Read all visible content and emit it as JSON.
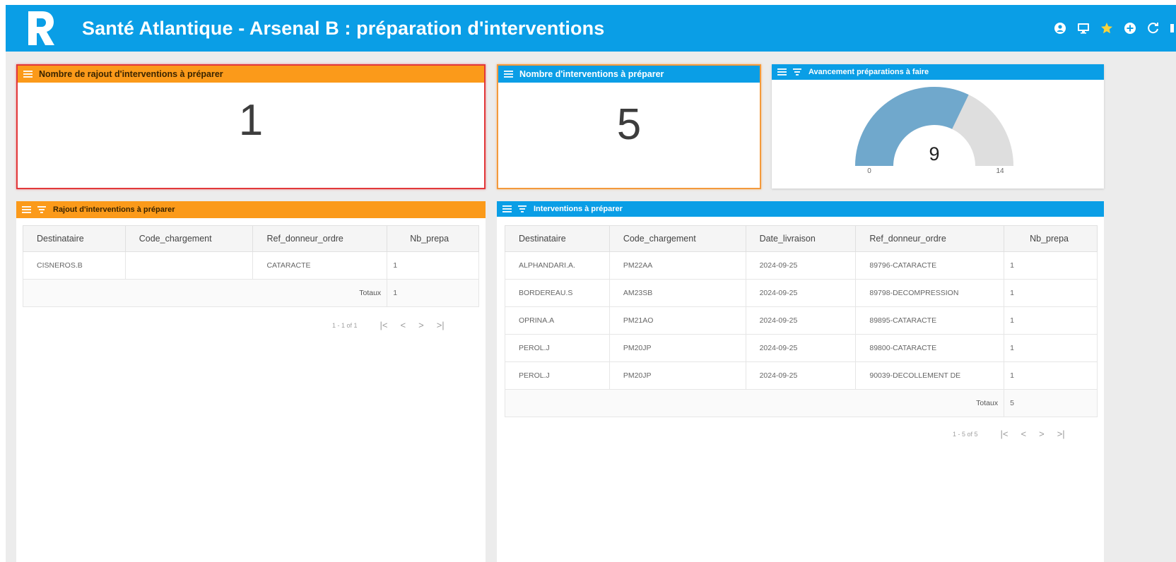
{
  "header": {
    "title": "Santé Atlantique - Arsenal B : préparation d'interventions",
    "icons": [
      "user-circle-icon",
      "monitor-icon",
      "star-icon",
      "plus-circle-icon",
      "refresh-icon"
    ]
  },
  "colors": {
    "header": "#0a9ee6",
    "orange": "#fb9a1a",
    "kpi_border_red": "#e2383a",
    "kpi_border_orange": "#f39a3c",
    "gauge_fill": "#70a8cc",
    "gauge_rest": "#dedede"
  },
  "kpi_rajout": {
    "title": "Nombre de rajout d'interventions à préparer",
    "value": "1"
  },
  "kpi_interventions": {
    "title": "Nombre d'interventions à préparer",
    "value": "5"
  },
  "gauge": {
    "title": "Avancement préparations à faire",
    "value": 9,
    "min": 0,
    "max": 14,
    "value_label": "9",
    "min_label": "0",
    "max_label": "14"
  },
  "rajout_table": {
    "title": "Rajout d'interventions à préparer",
    "columns": [
      "Destinataire",
      "Code_chargement",
      "Ref_donneur_ordre",
      "Nb_prepa"
    ],
    "rows": [
      [
        "CISNEROS.B",
        "",
        "CATARACTE",
        "1"
      ]
    ],
    "totals_label": "Totaux",
    "totals_value": "1",
    "pager_info": "1 - 1 of 1"
  },
  "interventions_table": {
    "title": "Interventions à préparer",
    "columns": [
      "Destinataire",
      "Code_chargement",
      "Date_livraison",
      "Ref_donneur_ordre",
      "Nb_prepa"
    ],
    "rows": [
      [
        "ALPHANDARI.A.",
        "PM22AA",
        "2024-09-25",
        "89796-CATARACTE",
        "1"
      ],
      [
        "BORDEREAU.S",
        "AM23SB",
        "2024-09-25",
        "89798-DECOMPRESSION",
        "1"
      ],
      [
        "OPRINA.A",
        "PM21AO",
        "2024-09-25",
        "89895-CATARACTE",
        "1"
      ],
      [
        "PEROL.J",
        "PM20JP",
        "2024-09-25",
        "89800-CATARACTE",
        "1"
      ],
      [
        "PEROL.J",
        "PM20JP",
        "2024-09-25",
        "90039-DECOLLEMENT DE",
        "1"
      ]
    ],
    "totals_label": "Totaux",
    "totals_value": "5",
    "pager_info": "1 - 5 of 5"
  },
  "pager_buttons": {
    "first": "|<",
    "prev": "<",
    "next": ">",
    "last": ">|"
  }
}
